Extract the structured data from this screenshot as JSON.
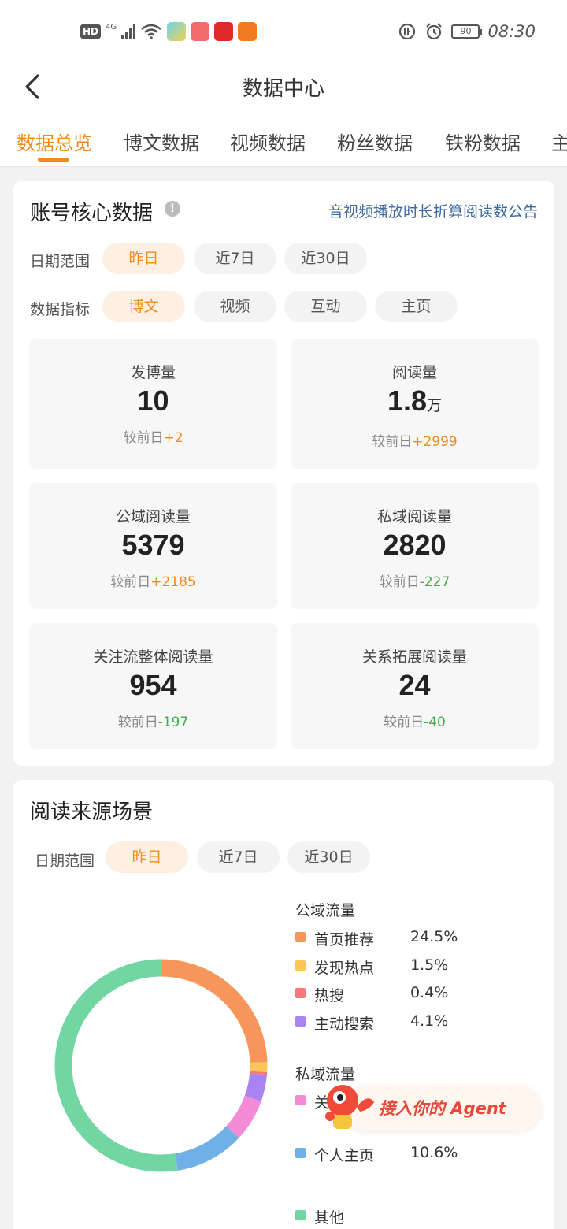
{
  "status_bar": {
    "hd": "HD",
    "network": "4G",
    "battery": "90",
    "time": "08:30"
  },
  "header": {
    "title": "数据中心"
  },
  "tabs": [
    {
      "label": "数据总览",
      "active": true
    },
    {
      "label": "博文数据",
      "active": false
    },
    {
      "label": "视频数据",
      "active": false
    },
    {
      "label": "粉丝数据",
      "active": false
    },
    {
      "label": "铁粉数据",
      "active": false
    },
    {
      "label": "主",
      "active": false
    }
  ],
  "core": {
    "title": "账号核心数据",
    "info_glyph": "!",
    "notice": "音视频播放时长折算阅读数公告",
    "date_label": "日期范围",
    "date_options": [
      "昨日",
      "近7日",
      "近30日"
    ],
    "metric_label": "数据指标",
    "metric_options": [
      "博文",
      "视频",
      "互动",
      "主页"
    ],
    "stats": [
      {
        "label": "发博量",
        "value": "10",
        "unit": "",
        "cmp_prefix": "较前日",
        "cmp": "+2",
        "trend": "up"
      },
      {
        "label": "阅读量",
        "value": "1.8",
        "unit": "万",
        "cmp_prefix": "较前日",
        "cmp": "+2999",
        "trend": "up"
      },
      {
        "label": "公域阅读量",
        "value": "5379",
        "unit": "",
        "cmp_prefix": "较前日",
        "cmp": "+2185",
        "trend": "up"
      },
      {
        "label": "私域阅读量",
        "value": "2820",
        "unit": "",
        "cmp_prefix": "较前日",
        "cmp": "-227",
        "trend": "down"
      },
      {
        "label": "关注流整体阅读量",
        "value": "954",
        "unit": "",
        "cmp_prefix": "较前日",
        "cmp": "-197",
        "trend": "down"
      },
      {
        "label": "关系拓展阅读量",
        "value": "24",
        "unit": "",
        "cmp_prefix": "较前日",
        "cmp": "-40",
        "trend": "down"
      }
    ]
  },
  "source": {
    "title": "阅读来源场景",
    "date_label": "日期范围",
    "date_options": [
      "昨日",
      "近7日",
      "近30日"
    ],
    "public_group": "公域流量",
    "public_items": [
      {
        "name": "首页推荐",
        "value": "24.5%",
        "color": "#f7965a"
      },
      {
        "name": "发现热点",
        "value": "1.5%",
        "color": "#fbc654"
      },
      {
        "name": "热搜",
        "value": "0.4%",
        "color": "#f47b7b"
      },
      {
        "name": "主动搜索",
        "value": "4.1%",
        "color": "#a883f2"
      }
    ],
    "private_group": "私域流量",
    "private_items": [
      {
        "name": "关",
        "value": "",
        "color": "#f48bd6"
      },
      {
        "name": "个人主页",
        "value": "10.6%",
        "color": "#6fb0e6"
      }
    ],
    "other_items": [
      {
        "name": "其他",
        "value": "",
        "color": "#72d6a2"
      }
    ],
    "chart_data": {
      "type": "pie",
      "categories": [
        "首页推荐",
        "发现热点",
        "热搜",
        "主动搜索",
        "关注流",
        "个人主页",
        "其他"
      ],
      "values": [
        24.5,
        1.5,
        0.4,
        4.1,
        6.4,
        10.6,
        52.5
      ],
      "colors": [
        "#f7965a",
        "#fbc654",
        "#f47b7b",
        "#a883f2",
        "#f48bd6",
        "#6fb0e6",
        "#72d6a2"
      ]
    }
  },
  "agent": {
    "label": "接入你的 Agent"
  }
}
